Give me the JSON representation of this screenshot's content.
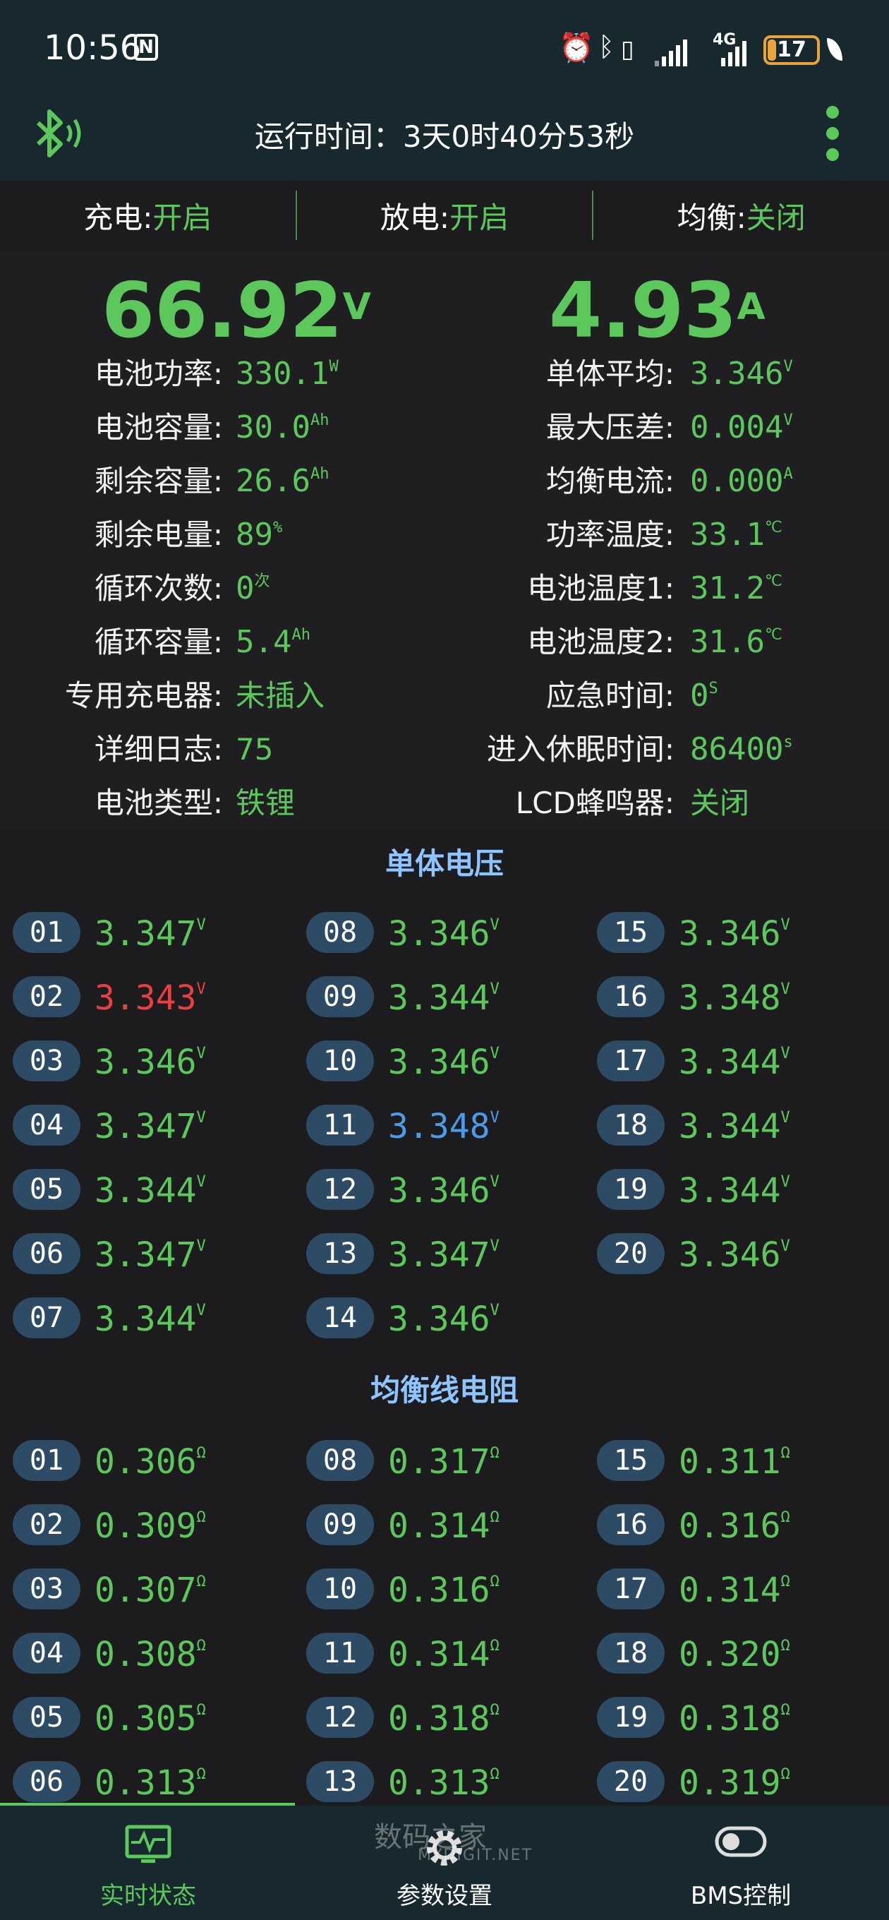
{
  "status_bar": {
    "time": "10:56",
    "nfc_label": "N",
    "network_label": "4G",
    "battery_level": "17",
    "battery_fraction": 0.17
  },
  "header": {
    "runtime": "运行时间：3天0时40分53秒"
  },
  "switches": [
    {
      "label": "充电:",
      "value": "开启"
    },
    {
      "label": "放电:",
      "value": "开启"
    },
    {
      "label": "均衡:",
      "value": "关闭"
    }
  ],
  "voltage": {
    "value": "66.92",
    "unit": "V"
  },
  "current": {
    "value": "4.93",
    "unit": "A"
  },
  "left_stats": [
    {
      "label": "电池功率:",
      "value": "330.1",
      "unit": "W",
      "mono": true
    },
    {
      "label": "电池容量:",
      "value": "30.0",
      "unit": "Ah",
      "mono": true
    },
    {
      "label": "剩余容量:",
      "value": "26.6",
      "unit": "Ah",
      "mono": true
    },
    {
      "label": "剩余电量:",
      "value": "89",
      "unit": "%",
      "mono": true
    },
    {
      "label": "循环次数:",
      "value": "0",
      "unit": "次",
      "mono": true
    },
    {
      "label": "循环容量:",
      "value": "5.4",
      "unit": "Ah",
      "mono": true
    },
    {
      "label": "专用充电器:",
      "value": "未插入",
      "unit": "",
      "mono": false
    },
    {
      "label": "详细日志:",
      "value": "75",
      "unit": "",
      "mono": false
    },
    {
      "label": "电池类型:",
      "value": "铁锂",
      "unit": "",
      "mono": false
    }
  ],
  "right_stats": [
    {
      "label": "单体平均:",
      "value": "3.346",
      "unit": "V",
      "mono": true
    },
    {
      "label": "最大压差:",
      "value": "0.004",
      "unit": "V",
      "mono": true
    },
    {
      "label": "均衡电流:",
      "value": "0.000",
      "unit": "A",
      "mono": true
    },
    {
      "label": "功率温度:",
      "value": "33.1",
      "unit": "℃",
      "mono": true
    },
    {
      "label": "电池温度1:",
      "value": "31.2",
      "unit": "℃",
      "mono": true
    },
    {
      "label": "电池温度2:",
      "value": "31.6",
      "unit": "℃",
      "mono": true
    },
    {
      "label": "应急时间:",
      "value": "0",
      "unit": "S",
      "mono": true
    },
    {
      "label": "进入休眠时间:",
      "value": "86400",
      "unit": "s",
      "mono": true
    },
    {
      "label": "LCD蜂鸣器:",
      "value": "关闭",
      "unit": "",
      "mono": false
    }
  ],
  "cell_voltage": {
    "title": "单体电压",
    "unit": "V",
    "cells": [
      {
        "id": "01",
        "value": "3.347"
      },
      {
        "id": "02",
        "value": "3.343",
        "state": "low"
      },
      {
        "id": "03",
        "value": "3.346"
      },
      {
        "id": "04",
        "value": "3.347"
      },
      {
        "id": "05",
        "value": "3.344"
      },
      {
        "id": "06",
        "value": "3.347"
      },
      {
        "id": "07",
        "value": "3.344"
      },
      {
        "id": "08",
        "value": "3.346"
      },
      {
        "id": "09",
        "value": "3.344"
      },
      {
        "id": "10",
        "value": "3.346"
      },
      {
        "id": "11",
        "value": "3.348",
        "state": "high"
      },
      {
        "id": "12",
        "value": "3.346"
      },
      {
        "id": "13",
        "value": "3.347"
      },
      {
        "id": "14",
        "value": "3.346"
      },
      {
        "id": "15",
        "value": "3.346"
      },
      {
        "id": "16",
        "value": "3.348"
      },
      {
        "id": "17",
        "value": "3.344"
      },
      {
        "id": "18",
        "value": "3.344"
      },
      {
        "id": "19",
        "value": "3.344"
      },
      {
        "id": "20",
        "value": "3.346"
      }
    ]
  },
  "balance_resistance": {
    "title": "均衡线电阻",
    "unit": "Ω",
    "cells": [
      {
        "id": "01",
        "value": "0.306"
      },
      {
        "id": "02",
        "value": "0.309"
      },
      {
        "id": "03",
        "value": "0.307"
      },
      {
        "id": "04",
        "value": "0.308"
      },
      {
        "id": "05",
        "value": "0.305"
      },
      {
        "id": "06",
        "value": "0.313"
      },
      {
        "id": "08",
        "value": "0.317"
      },
      {
        "id": "09",
        "value": "0.314"
      },
      {
        "id": "10",
        "value": "0.316"
      },
      {
        "id": "11",
        "value": "0.314"
      },
      {
        "id": "12",
        "value": "0.318"
      },
      {
        "id": "13",
        "value": "0.313"
      },
      {
        "id": "15",
        "value": "0.311"
      },
      {
        "id": "16",
        "value": "0.316"
      },
      {
        "id": "17",
        "value": "0.314"
      },
      {
        "id": "18",
        "value": "0.320"
      },
      {
        "id": "19",
        "value": "0.318"
      },
      {
        "id": "20",
        "value": "0.319"
      }
    ]
  },
  "nav": [
    {
      "label": "实时状态",
      "icon": "monitor-pulse-icon",
      "active": true
    },
    {
      "label": "参数设置",
      "icon": "gear-icon",
      "active": false
    },
    {
      "label": "BMS控制",
      "icon": "toggle-icon",
      "active": false
    }
  ],
  "watermark": {
    "line1": "数码之家",
    "line2": "MYDIGIT.NET"
  },
  "colors": {
    "accent": "#5cc85c",
    "header_bg": "#17282e",
    "badge_bg": "#2e4b66",
    "low": "#e84040",
    "high": "#4c9be8",
    "section_title": "#8ec4ff"
  }
}
